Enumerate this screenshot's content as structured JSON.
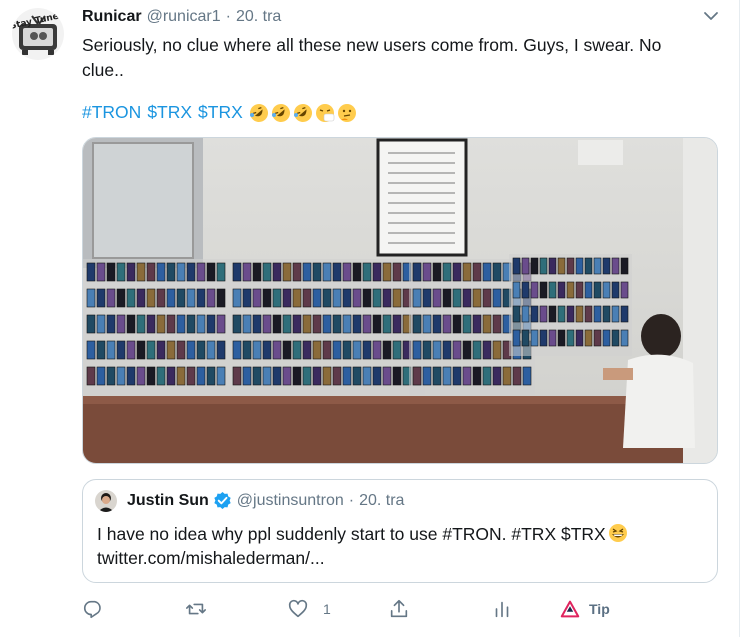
{
  "tweet": {
    "display_name": "Runicar",
    "handle": "@runicar1",
    "separator": "·",
    "time": "20. tra",
    "text_line1": "Seriously, no clue where all these new users come from. Guys, I swear. No",
    "text_line2": "clue..",
    "hashtags": [
      "#TRON",
      "$TRX",
      "$TRX"
    ],
    "emojis": [
      "rolling-on-floor-laughing",
      "rolling-on-floor-laughing",
      "rolling-on-floor-laughing",
      "sneezing-face",
      "thinking-face"
    ],
    "avatar_text": "Stay Tuned"
  },
  "quote": {
    "display_name": "Justin Sun",
    "handle": "@justinsuntron",
    "separator": "·",
    "time": "20. tra",
    "text_line1": "I have no idea why ppl suddenly start to use #TRON. #TRX $TRX",
    "text_line2": "twitter.com/mishalederman/...",
    "verified": true
  },
  "actions": {
    "reply_count": "",
    "retweet_count": "",
    "like_count": "1",
    "tip_label": "Tip"
  },
  "colors": {
    "link": "#1b95e0",
    "secondary": "#657786",
    "border": "#ccd6dd",
    "verified": "#1da1f2"
  },
  "icons": [
    "chevron-down-icon",
    "reply-icon",
    "retweet-icon",
    "like-icon",
    "share-icon",
    "analytics-icon",
    "tip-icon",
    "verified-badge-icon"
  ]
}
